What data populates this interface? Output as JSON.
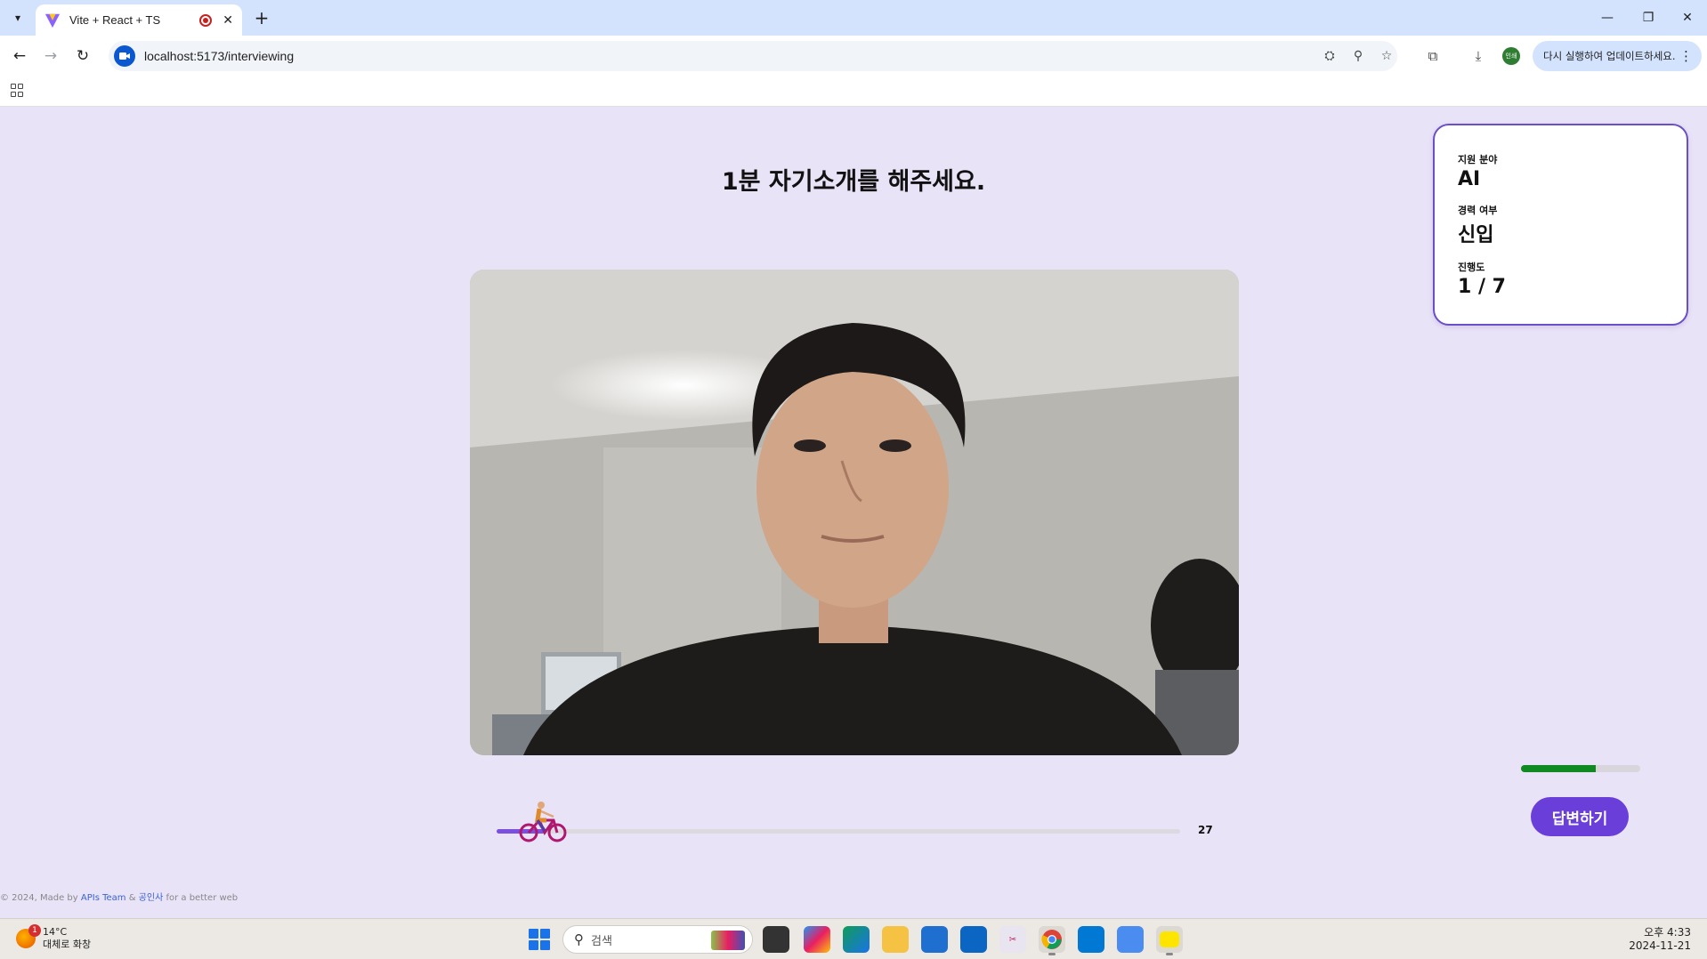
{
  "browser": {
    "tab_title": "Vite + React + TS",
    "url": "localhost:5173/interviewing",
    "update_button": "다시 실행하여 업데이트하세요.",
    "profile_label": "인쇄"
  },
  "interview": {
    "question": "1분 자기소개를 해주세요.",
    "info": {
      "field_label": "지원 분야",
      "field_value": "AI",
      "career_label": "경력 여부",
      "career_value": "신입",
      "progress_label": "진행도",
      "progress_value": "1 / 7"
    },
    "timer": {
      "remaining": "27",
      "progress_fraction": 0.07
    },
    "volume_fraction": 0.63,
    "answer_button": "답변하기"
  },
  "footer": {
    "prefix": "© 2024, Made by ",
    "team": "APIs Team",
    "amp": " & ",
    "partner": "공인사",
    "suffix": " for a better web"
  },
  "taskbar": {
    "weather_badge": "1",
    "weather_temp": "14°C",
    "weather_desc": "대체로 화창",
    "search_placeholder": "검색",
    "clock_time": "오후 4:33",
    "clock_date": "2024-11-21"
  },
  "colors": {
    "page_bg": "#e9e3f7",
    "accent": "#6a3fd9",
    "volume": "#0f8a23",
    "timer": "#7b4fe0"
  }
}
